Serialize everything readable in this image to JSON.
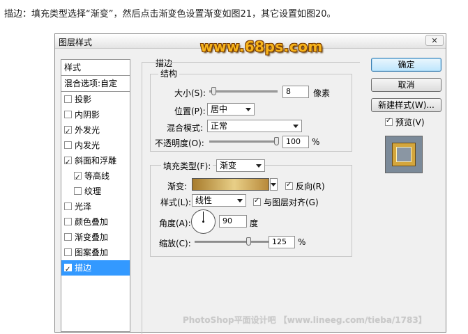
{
  "caption": "描边：填充类型选择“渐变”，然后点击渐变色设置渐变如图21，其它设置如图20。",
  "dialog": {
    "title": "图层样式",
    "close_glyph": "✕"
  },
  "logo_text": "www.68ps.com",
  "styles_panel": {
    "header": "样式",
    "blend_options": "混合选项:自定",
    "items": [
      {
        "label": "投影",
        "checked": false
      },
      {
        "label": "内阴影",
        "checked": false
      },
      {
        "label": "外发光",
        "checked": true
      },
      {
        "label": "内发光",
        "checked": false
      },
      {
        "label": "斜面和浮雕",
        "checked": true
      },
      {
        "label": "等高线",
        "checked": true
      },
      {
        "label": "纹理",
        "checked": false
      },
      {
        "label": "光泽",
        "checked": false
      },
      {
        "label": "颜色叠加",
        "checked": false
      },
      {
        "label": "渐变叠加",
        "checked": false
      },
      {
        "label": "图案叠加",
        "checked": false
      },
      {
        "label": "描边",
        "checked": true
      }
    ]
  },
  "stroke": {
    "section_title": "描边",
    "structure_title": "结构",
    "size_label": "大小(S):",
    "size_value": "8",
    "size_unit": "像素",
    "position_label": "位置(P):",
    "position_value": "居中",
    "blend_mode_label": "混合模式:",
    "blend_mode_value": "正常",
    "opacity_label": "不透明度(O):",
    "opacity_value": "100",
    "opacity_unit": "%",
    "fill_type_label": "填充类型(F):",
    "fill_type_value": "渐变",
    "gradient_label": "渐变:",
    "reverse_label": "反向(R)",
    "reverse_checked": true,
    "style_label": "样式(L):",
    "style_value": "线性",
    "align_label": "与图层对齐(G)",
    "align_checked": true,
    "angle_label": "角度(A):",
    "angle_value": "90",
    "angle_unit": "度",
    "scale_label": "缩放(C):",
    "scale_value": "125",
    "scale_unit": "%",
    "size_level_pct": 3,
    "opacity_level_pct": 100,
    "scale_level_pct": 62
  },
  "buttons": {
    "ok": "确定",
    "cancel": "取消",
    "new_style": "新建样式(W)...",
    "preview_label": "预览(V)",
    "preview_checked": true
  },
  "gradient_colors": [
    "#a77b2c",
    "#e8cf87",
    "#b8893a"
  ],
  "watermark": "PhotoShop平面设计吧 【www.lineeg.com/tieba/1783】"
}
